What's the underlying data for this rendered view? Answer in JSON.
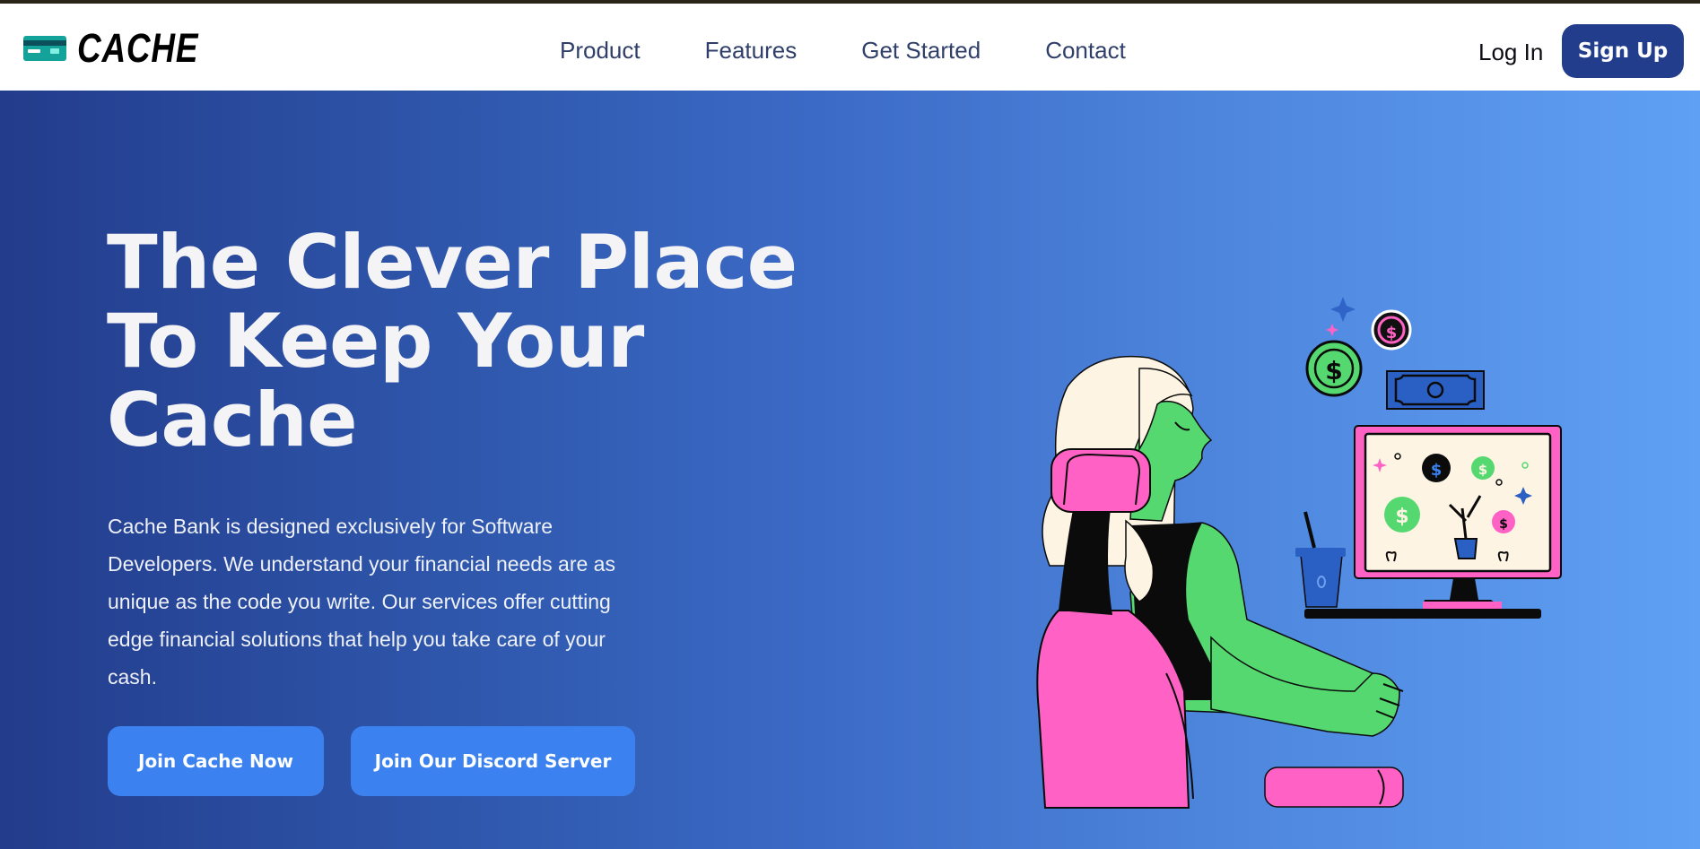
{
  "brand": {
    "name": "CACHE",
    "logo_icon": "credit-card-icon"
  },
  "nav": {
    "links": [
      "Product",
      "Features",
      "Get Started",
      "Contact"
    ],
    "login_label": "Log In",
    "signup_label": "Sign Up"
  },
  "hero": {
    "headline_lines": [
      "The Clever Place",
      "To Keep Your",
      "Cache"
    ],
    "description": "Cache Bank is designed exclusively for Software Developers. We understand your financial needs are as unique as the code you write. Our services offer cutting edge financial solutions that help you take care of your cash.",
    "primary_cta": "Join Cache Now",
    "secondary_cta": "Join Our Discord Server",
    "illustration": "person-at-computer-illustration"
  },
  "colors": {
    "nav_button": "#233d8d",
    "cta": "#3b82f0",
    "gradient_start": "#233c8c",
    "gradient_end": "#5fa0f4",
    "accent_green": "#55d86f",
    "accent_pink": "#ff62c4"
  }
}
